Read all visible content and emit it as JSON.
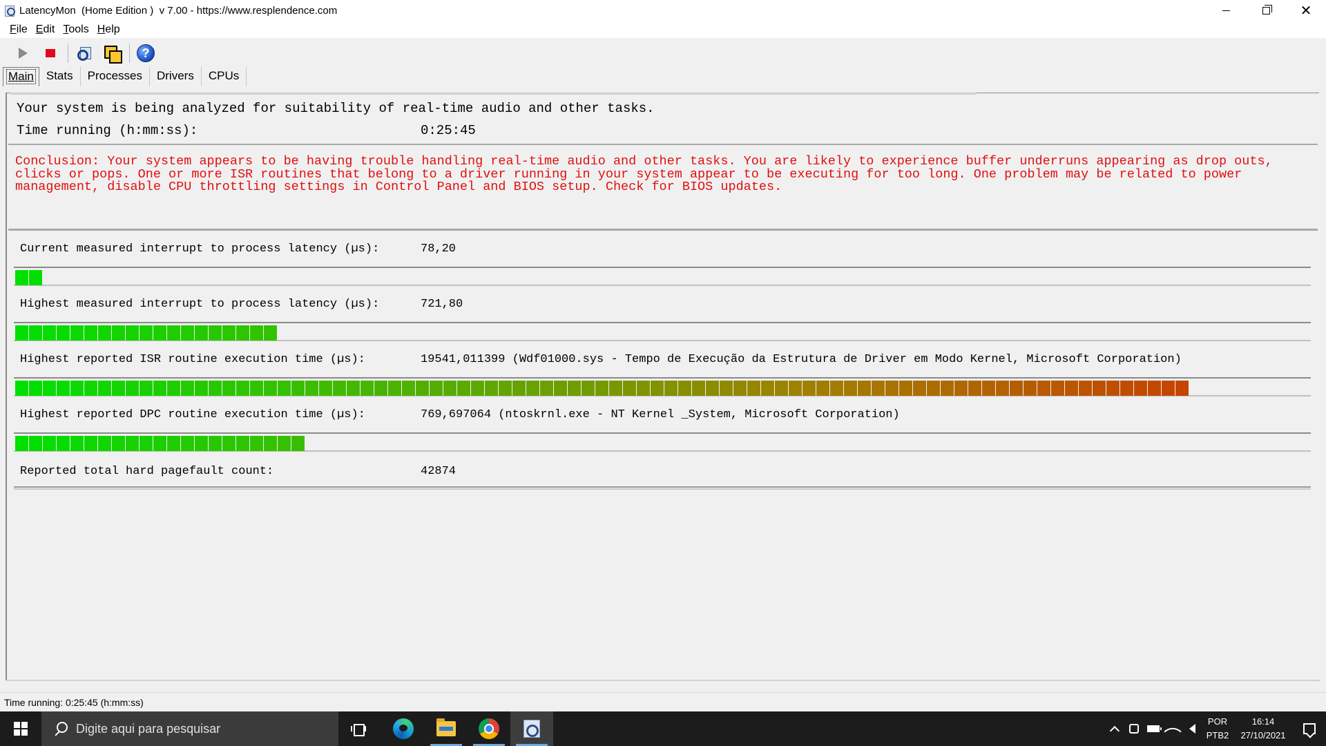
{
  "window": {
    "title": "LatencyMon  (Home Edition )  v 7.00 - https://www.resplendence.com",
    "minimize_label": "",
    "maximize_label": "",
    "close_label": "✕"
  },
  "menu": {
    "items": [
      {
        "key": "F",
        "rest": "ile"
      },
      {
        "key": "E",
        "rest": "dit"
      },
      {
        "key": "T",
        "rest": "ools"
      },
      {
        "key": "H",
        "rest": "elp"
      }
    ]
  },
  "toolbar": {
    "icons": [
      "play-icon",
      "stop-icon",
      "report-icon",
      "copy-icon",
      "help-icon"
    ],
    "help_glyph": "?"
  },
  "tabs": [
    {
      "label": "Main",
      "active": true
    },
    {
      "label": "Stats",
      "active": false
    },
    {
      "label": "Processes",
      "active": false
    },
    {
      "label": "Drivers",
      "active": false
    },
    {
      "label": "CPUs",
      "active": false
    }
  ],
  "main": {
    "analysis_text": "Your system is being analyzed for suitability of real-time audio and other tasks.",
    "time_running_label": "Time running (h:mm:ss):",
    "time_running_value": "0:25:45",
    "conclusion": "Conclusion: Your system appears to be having trouble handling real-time audio and other tasks. You are likely to experience buffer underruns appearing as drop outs, clicks or pops. One or more ISR routines that belong to a driver running in your system appear to be executing for too long. One problem may be related to power management, disable CPU throttling settings in Control Panel and BIOS setup. Check for BIOS updates.",
    "conclusion_color": "#e01010",
    "metrics": [
      {
        "label": "Current measured interrupt to process latency (µs):",
        "value": "78,20",
        "segments": 2
      },
      {
        "label": "Highest measured interrupt to process latency (µs):",
        "value": "721,80",
        "segments": 19
      },
      {
        "label": "Highest reported ISR routine execution time (µs):",
        "value": "19541,011399  (Wdf01000.sys - Tempo de Execução da Estrutura de Driver em Modo Kernel, Microsoft Corporation)",
        "segments": 85
      },
      {
        "label": "Highest reported DPC routine execution time (µs):",
        "value": "769,697064  (ntoskrnl.exe - NT Kernel _System, Microsoft Corporation)",
        "segments": 21
      }
    ],
    "total_segments_full_scale": 115,
    "pagefault_label": "Reported total hard pagefault count:",
    "pagefault_value": "42874",
    "colors": {
      "bar_start": "#00e000",
      "bar_mid": "#a08000",
      "bar_end": "#f00000"
    }
  },
  "statusbar": {
    "text": "Time running: 0:25:45  (h:mm:ss)"
  },
  "taskbar": {
    "search_placeholder": "Digite aqui para pesquisar",
    "apps": [
      "task-view-icon",
      "edge-icon",
      "file-explorer-icon",
      "chrome-icon",
      "latencymon-icon"
    ],
    "lang_line1": "POR",
    "lang_line2": "PTB2",
    "time": "16:14",
    "date": "27/10/2021"
  }
}
